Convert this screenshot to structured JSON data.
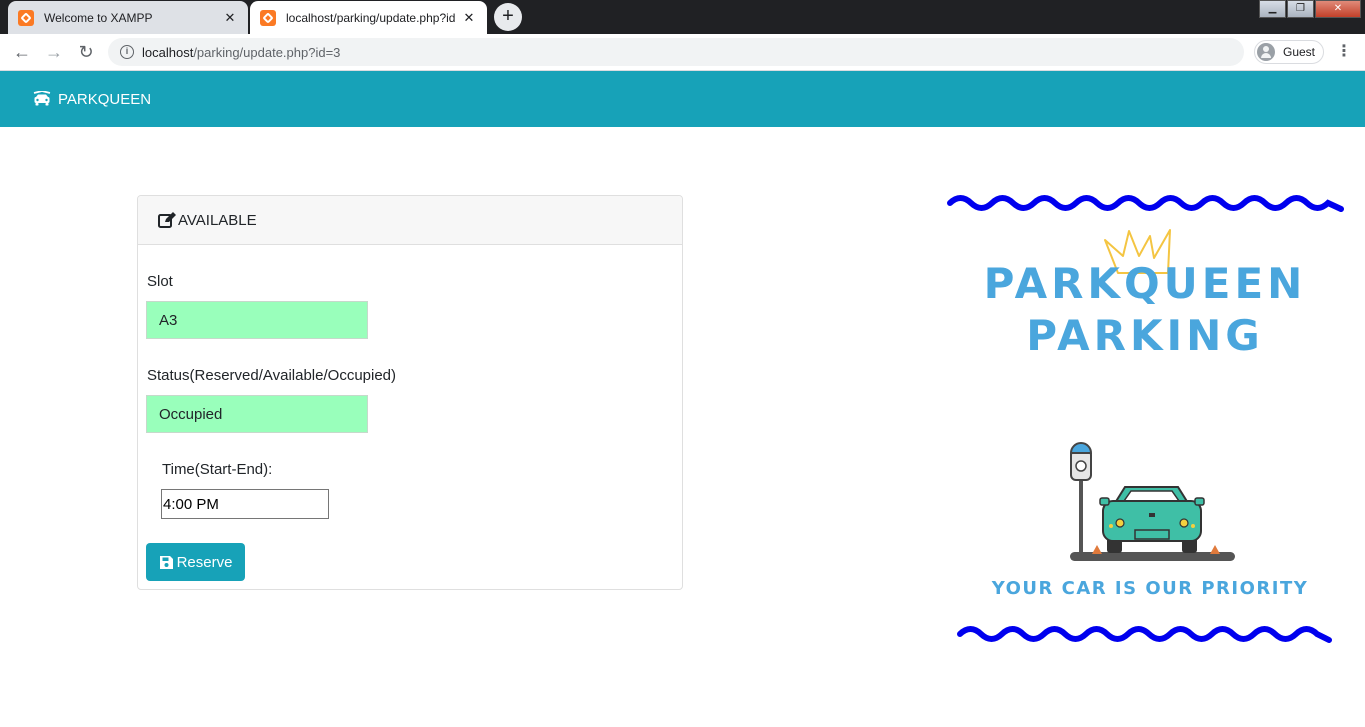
{
  "browser": {
    "tabs": [
      {
        "title": "Welcome to XAMPP",
        "active": false
      },
      {
        "title": "localhost/parking/update.php?id",
        "active": true
      }
    ],
    "url_host": "localhost",
    "url_path": "/parking/update.php?id=3",
    "profile_name": "Guest"
  },
  "navbar": {
    "brand": "PARKQUEEN"
  },
  "card": {
    "header_title": "AVAILABLE",
    "slot_label": "Slot",
    "slot_value": "A3",
    "status_label": "Status(Reserved/Available/Occupied)",
    "status_value": "Occupied",
    "time_label": "Time(Start-End):",
    "time_value": "4:00 PM",
    "reserve_label": "Reserve"
  },
  "logo": {
    "line1": "PARKQUEEN",
    "line2": "PARKING",
    "tagline": "YOUR CAR IS OUR PRIORITY"
  },
  "colors": {
    "navbar_bg": "#17a2b8",
    "input_fill": "#99ffbb",
    "logo_text": "#4aa6dd",
    "wave": "#0000ee",
    "crown": "#f4c542",
    "car_body": "#3fbfa6"
  }
}
